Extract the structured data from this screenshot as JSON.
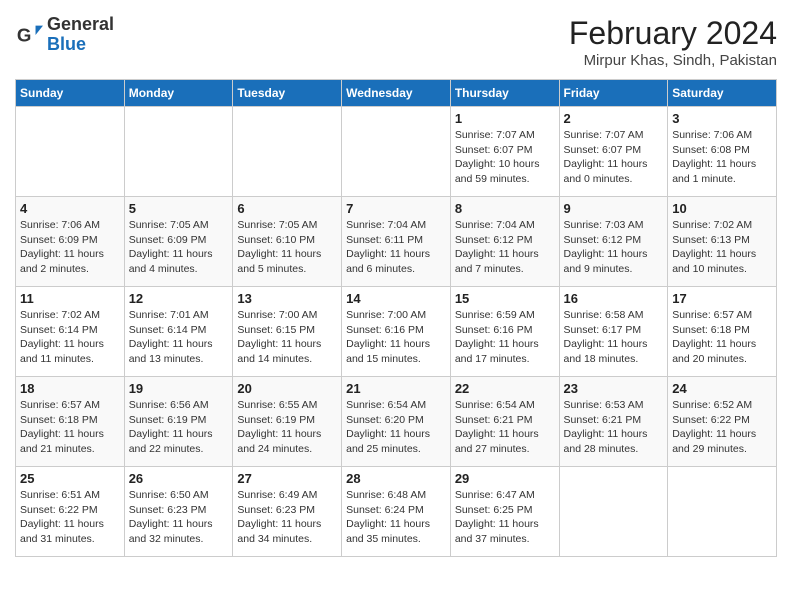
{
  "logo": {
    "line1": "General",
    "line2": "Blue"
  },
  "title": "February 2024",
  "subtitle": "Mirpur Khas, Sindh, Pakistan",
  "days_of_week": [
    "Sunday",
    "Monday",
    "Tuesday",
    "Wednesday",
    "Thursday",
    "Friday",
    "Saturday"
  ],
  "weeks": [
    [
      {
        "day": "",
        "info": ""
      },
      {
        "day": "",
        "info": ""
      },
      {
        "day": "",
        "info": ""
      },
      {
        "day": "",
        "info": ""
      },
      {
        "day": "1",
        "info": "Sunrise: 7:07 AM\nSunset: 6:07 PM\nDaylight: 10 hours and 59 minutes."
      },
      {
        "day": "2",
        "info": "Sunrise: 7:07 AM\nSunset: 6:07 PM\nDaylight: 11 hours and 0 minutes."
      },
      {
        "day": "3",
        "info": "Sunrise: 7:06 AM\nSunset: 6:08 PM\nDaylight: 11 hours and 1 minute."
      }
    ],
    [
      {
        "day": "4",
        "info": "Sunrise: 7:06 AM\nSunset: 6:09 PM\nDaylight: 11 hours and 2 minutes."
      },
      {
        "day": "5",
        "info": "Sunrise: 7:05 AM\nSunset: 6:09 PM\nDaylight: 11 hours and 4 minutes."
      },
      {
        "day": "6",
        "info": "Sunrise: 7:05 AM\nSunset: 6:10 PM\nDaylight: 11 hours and 5 minutes."
      },
      {
        "day": "7",
        "info": "Sunrise: 7:04 AM\nSunset: 6:11 PM\nDaylight: 11 hours and 6 minutes."
      },
      {
        "day": "8",
        "info": "Sunrise: 7:04 AM\nSunset: 6:12 PM\nDaylight: 11 hours and 7 minutes."
      },
      {
        "day": "9",
        "info": "Sunrise: 7:03 AM\nSunset: 6:12 PM\nDaylight: 11 hours and 9 minutes."
      },
      {
        "day": "10",
        "info": "Sunrise: 7:02 AM\nSunset: 6:13 PM\nDaylight: 11 hours and 10 minutes."
      }
    ],
    [
      {
        "day": "11",
        "info": "Sunrise: 7:02 AM\nSunset: 6:14 PM\nDaylight: 11 hours and 11 minutes."
      },
      {
        "day": "12",
        "info": "Sunrise: 7:01 AM\nSunset: 6:14 PM\nDaylight: 11 hours and 13 minutes."
      },
      {
        "day": "13",
        "info": "Sunrise: 7:00 AM\nSunset: 6:15 PM\nDaylight: 11 hours and 14 minutes."
      },
      {
        "day": "14",
        "info": "Sunrise: 7:00 AM\nSunset: 6:16 PM\nDaylight: 11 hours and 15 minutes."
      },
      {
        "day": "15",
        "info": "Sunrise: 6:59 AM\nSunset: 6:16 PM\nDaylight: 11 hours and 17 minutes."
      },
      {
        "day": "16",
        "info": "Sunrise: 6:58 AM\nSunset: 6:17 PM\nDaylight: 11 hours and 18 minutes."
      },
      {
        "day": "17",
        "info": "Sunrise: 6:57 AM\nSunset: 6:18 PM\nDaylight: 11 hours and 20 minutes."
      }
    ],
    [
      {
        "day": "18",
        "info": "Sunrise: 6:57 AM\nSunset: 6:18 PM\nDaylight: 11 hours and 21 minutes."
      },
      {
        "day": "19",
        "info": "Sunrise: 6:56 AM\nSunset: 6:19 PM\nDaylight: 11 hours and 22 minutes."
      },
      {
        "day": "20",
        "info": "Sunrise: 6:55 AM\nSunset: 6:19 PM\nDaylight: 11 hours and 24 minutes."
      },
      {
        "day": "21",
        "info": "Sunrise: 6:54 AM\nSunset: 6:20 PM\nDaylight: 11 hours and 25 minutes."
      },
      {
        "day": "22",
        "info": "Sunrise: 6:54 AM\nSunset: 6:21 PM\nDaylight: 11 hours and 27 minutes."
      },
      {
        "day": "23",
        "info": "Sunrise: 6:53 AM\nSunset: 6:21 PM\nDaylight: 11 hours and 28 minutes."
      },
      {
        "day": "24",
        "info": "Sunrise: 6:52 AM\nSunset: 6:22 PM\nDaylight: 11 hours and 29 minutes."
      }
    ],
    [
      {
        "day": "25",
        "info": "Sunrise: 6:51 AM\nSunset: 6:22 PM\nDaylight: 11 hours and 31 minutes."
      },
      {
        "day": "26",
        "info": "Sunrise: 6:50 AM\nSunset: 6:23 PM\nDaylight: 11 hours and 32 minutes."
      },
      {
        "day": "27",
        "info": "Sunrise: 6:49 AM\nSunset: 6:23 PM\nDaylight: 11 hours and 34 minutes."
      },
      {
        "day": "28",
        "info": "Sunrise: 6:48 AM\nSunset: 6:24 PM\nDaylight: 11 hours and 35 minutes."
      },
      {
        "day": "29",
        "info": "Sunrise: 6:47 AM\nSunset: 6:25 PM\nDaylight: 11 hours and 37 minutes."
      },
      {
        "day": "",
        "info": ""
      },
      {
        "day": "",
        "info": ""
      }
    ]
  ]
}
